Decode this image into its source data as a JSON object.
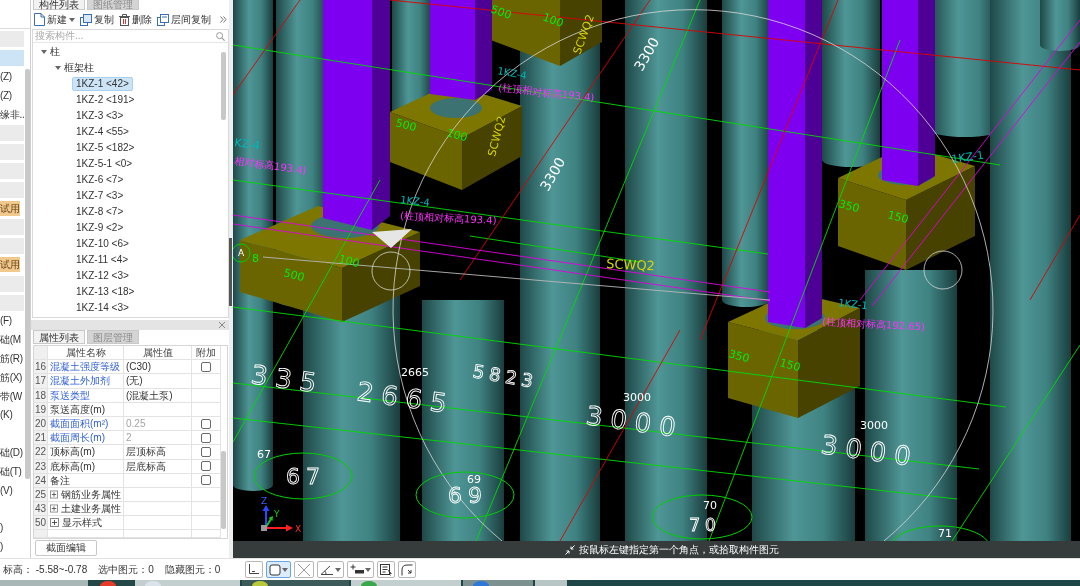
{
  "left_strip": {
    "items": [
      {
        "kind": "bar",
        "selected": false
      },
      {
        "kind": "bar",
        "selected": true
      },
      {
        "kind": "text",
        "label": "(Z)",
        "selected": false
      },
      {
        "kind": "text",
        "label": "(Z)",
        "selected": false
      },
      {
        "kind": "text",
        "label": "缘非..",
        "selected": false
      },
      {
        "kind": "bar",
        "selected": false
      },
      {
        "kind": "bar",
        "selected": false
      },
      {
        "kind": "bar",
        "selected": false
      },
      {
        "kind": "bar",
        "selected": false
      },
      {
        "kind": "tag",
        "label": "试用",
        "selected": false
      },
      {
        "kind": "bar",
        "selected": false
      },
      {
        "kind": "bar",
        "selected": false
      },
      {
        "kind": "tag",
        "label": "试用",
        "selected": false
      },
      {
        "kind": "bar",
        "selected": false
      },
      {
        "kind": "bar",
        "selected": false
      },
      {
        "kind": "text",
        "label": "(F)",
        "selected": false
      },
      {
        "kind": "text",
        "label": "础(M",
        "selected": false
      },
      {
        "kind": "text",
        "label": "筋(R)",
        "selected": false
      },
      {
        "kind": "text",
        "label": "筋(X)",
        "selected": false
      },
      {
        "kind": "text",
        "label": "带(W",
        "selected": false
      },
      {
        "kind": "text",
        "label": "(K)",
        "selected": false
      },
      {
        "kind": "text",
        "label": "础(D)",
        "selected": false
      },
      {
        "kind": "text",
        "label": "础(T)",
        "selected": false
      },
      {
        "kind": "text",
        "label": "(V)",
        "selected": false
      },
      {
        "kind": "text",
        "label": ")",
        "selected": false
      },
      {
        "kind": "text",
        "label": ")",
        "selected": false
      }
    ]
  },
  "component_panel": {
    "tabs": [
      {
        "label": "构件列表",
        "selected": true
      },
      {
        "label": "图纸管理",
        "selected": false
      }
    ],
    "toolbar": [
      {
        "kind": "new",
        "label": "新建",
        "dropdown": true
      },
      {
        "kind": "copy",
        "label": "复制",
        "dropdown": false
      },
      {
        "kind": "delete",
        "label": "删除",
        "dropdown": false
      },
      {
        "kind": "layer_copy",
        "label": "层间复制",
        "dropdown": false
      }
    ],
    "search": {
      "placeholder": "搜索构件..."
    },
    "tree": [
      {
        "label": "柱",
        "expanded": true,
        "children": [
          {
            "label": "框架柱",
            "expanded": true,
            "children": [
              {
                "label": "1KZ-1 <42>",
                "selected": true
              },
              {
                "label": "1KZ-2 <191>",
                "selected": false
              },
              {
                "label": "1KZ-3 <3>",
                "selected": false
              },
              {
                "label": "1KZ-4 <55>",
                "selected": false
              },
              {
                "label": "1KZ-5 <182>",
                "selected": false
              },
              {
                "label": "1KZ-5-1 <0>",
                "selected": false
              },
              {
                "label": "1KZ-6 <7>",
                "selected": false
              },
              {
                "label": "1KZ-7 <3>",
                "selected": false
              },
              {
                "label": "1KZ-8 <7>",
                "selected": false
              },
              {
                "label": "1KZ-9 <2>",
                "selected": false
              },
              {
                "label": "1KZ-10 <6>",
                "selected": false
              },
              {
                "label": "1KZ-11 <4>",
                "selected": false
              },
              {
                "label": "1KZ-12 <3>",
                "selected": false
              },
              {
                "label": "1KZ-13 <18>",
                "selected": false
              },
              {
                "label": "1KZ-14 <3>",
                "selected": false
              }
            ]
          }
        ]
      }
    ]
  },
  "property_panel": {
    "tabs": [
      {
        "label": "属性列表",
        "selected": true
      },
      {
        "label": "图层管理",
        "selected": false
      }
    ],
    "columns": [
      "属性名称",
      "属性值",
      "附加"
    ],
    "rows": [
      {
        "kind": "property",
        "no": "16",
        "name": "混凝土强度等级",
        "public": true,
        "value": "(C30)",
        "readonly": false,
        "addon": {
          "checked": false
        }
      },
      {
        "kind": "property",
        "no": "17",
        "name": "混凝土外加剂",
        "public": true,
        "value": "(无)",
        "readonly": false
      },
      {
        "kind": "property",
        "no": "18",
        "name": "泵送类型",
        "public": true,
        "value": "(混凝土泵)",
        "readonly": false
      },
      {
        "kind": "property",
        "no": "19",
        "name": "泵送高度(m)",
        "public": false
      },
      {
        "kind": "property",
        "no": "20",
        "name": "截面面积(m²)",
        "public": true,
        "value": "0.25",
        "readonly": true,
        "addon": {
          "checked": false
        }
      },
      {
        "kind": "property",
        "no": "21",
        "name": "截面周长(m)",
        "public": true,
        "value": "2",
        "readonly": true,
        "addon": {
          "checked": false
        }
      },
      {
        "kind": "property",
        "no": "22",
        "name": "顶标高(m)",
        "public": false,
        "value": "层顶标高",
        "readonly": false,
        "addon": {
          "checked": false
        }
      },
      {
        "kind": "property",
        "no": "23",
        "name": "底标高(m)",
        "public": false,
        "value": "层底标高",
        "readonly": false,
        "addon": {
          "checked": false
        }
      },
      {
        "kind": "property",
        "no": "24",
        "name": "备注",
        "public": false,
        "addon": {
          "checked": false
        }
      },
      {
        "kind": "group",
        "no": "25",
        "name": "钢筋业务属性",
        "expanded": false
      },
      {
        "kind": "group",
        "no": "43",
        "name": "土建业务属性",
        "expanded": false
      },
      {
        "kind": "group",
        "no": "50",
        "name": "显示样式",
        "expanded": false
      }
    ],
    "buttons": [
      "截面编辑"
    ]
  },
  "viewport": {
    "labels": [
      {
        "text": "500",
        "kind": "size"
      },
      {
        "text": "100",
        "kind": "size"
      },
      {
        "text": "SCWQ2",
        "kind": "wall"
      },
      {
        "text": "3300",
        "kind": "dimension"
      },
      {
        "text": "1KZ-4",
        "kind": "component"
      },
      {
        "text": "(柱顶相对标高193.4)",
        "kind": "note"
      },
      {
        "text": "KZ-4",
        "kind": "component"
      },
      {
        "text": "相对标高193.4)",
        "kind": "note"
      },
      {
        "text": "500",
        "kind": "size"
      },
      {
        "text": "100",
        "kind": "size"
      },
      {
        "text": "SCWQ2",
        "kind": "wall"
      },
      {
        "text": "3300",
        "kind": "dimension"
      },
      {
        "text": "1KZ-1",
        "kind": "component"
      },
      {
        "text": "1KZ-4",
        "kind": "component"
      },
      {
        "text": "(柱顶相对标高193.4)",
        "kind": "note"
      },
      {
        "text": "350",
        "kind": "size"
      },
      {
        "text": "150",
        "kind": "size"
      },
      {
        "text": "100",
        "kind": "size"
      },
      {
        "text": "500",
        "kind": "size"
      },
      {
        "text": "8",
        "kind": "size"
      },
      {
        "text": "SCWQ2",
        "kind": "wall"
      },
      {
        "text": "1KZ-1",
        "kind": "component"
      },
      {
        "text": "(柱顶相对标高192.65)",
        "kind": "note"
      },
      {
        "text": "350",
        "kind": "size"
      },
      {
        "text": "150",
        "kind": "size"
      },
      {
        "text": "335",
        "kind": "outline"
      },
      {
        "text": "2665",
        "kind": "dimension"
      },
      {
        "text": "2665",
        "kind": "outline"
      },
      {
        "text": "5823",
        "kind": "outline"
      },
      {
        "text": "3000",
        "kind": "dimension"
      },
      {
        "text": "3000",
        "kind": "outline"
      },
      {
        "text": "3000",
        "kind": "dimension"
      },
      {
        "text": "3000",
        "kind": "outline"
      }
    ],
    "axis_bubbles": [
      {
        "number": "A"
      },
      {
        "tag": "67",
        "number": "67"
      },
      {
        "tag": "69",
        "number": "69"
      },
      {
        "tag": "70",
        "number": "70"
      },
      {
        "tag": "71"
      }
    ],
    "axis_labels": [
      "Z",
      "Y",
      "X"
    ],
    "prompt": "按鼠标左键指定第一个角点，或拾取构件图元"
  },
  "status_bar": {
    "items": [
      "标高： -5.58~-0.78",
      "选中图元：0",
      "隐藏图元：0"
    ],
    "tools": [
      {
        "kind": "corner",
        "selected": false,
        "dropdown": false
      },
      {
        "kind": "rectangle",
        "selected": true,
        "dropdown": true
      },
      {
        "kind": "cross",
        "selected": false,
        "dropdown": false
      },
      {
        "kind": "angle",
        "selected": false,
        "dropdown": true
      },
      {
        "kind": "plus_bar",
        "selected": false,
        "dropdown": true
      },
      {
        "kind": "frame",
        "selected": false,
        "dropdown": false
      },
      {
        "kind": "curve",
        "selected": false,
        "dropdown": false
      }
    ]
  }
}
